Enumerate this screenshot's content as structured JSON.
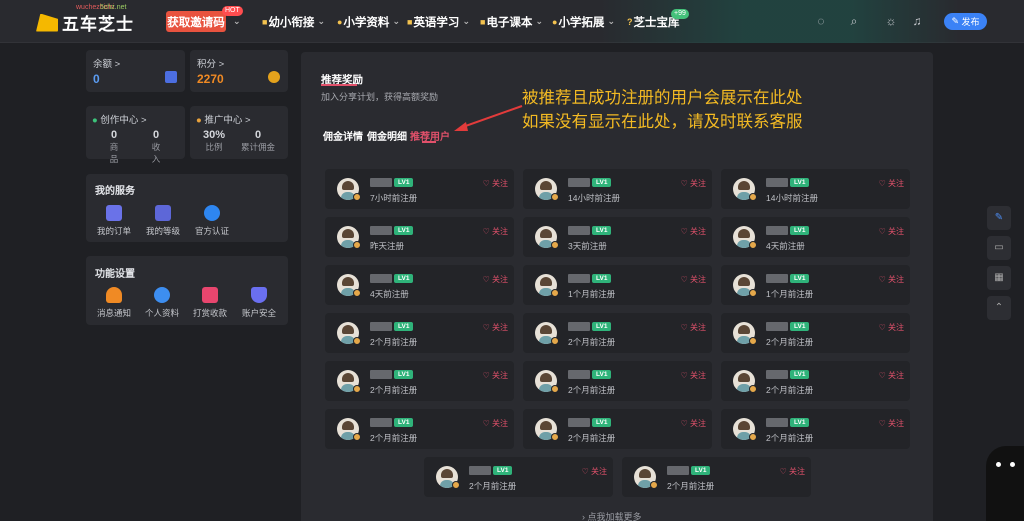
{
  "header": {
    "logo_text": "五车芝士",
    "logo_sub": "wuchezhishi",
    "logo_sub2": "5chz.net",
    "invite": "获取邀请码",
    "hot": "HOT",
    "nav": [
      "幼小衔接",
      "小学资料",
      "英语学习",
      "电子课本",
      "小学拓展",
      "芝士宝库"
    ],
    "badge99": "+99",
    "publish": "发布"
  },
  "left": {
    "balance_label": "余额 >",
    "balance_value": "0",
    "points_label": "积分 >",
    "points_value": "2270",
    "creation_title": "创作中心 >",
    "promo_title": "推广中心 >",
    "creation_stats": [
      {
        "v": "0",
        "l": "商品"
      },
      {
        "v": "0",
        "l": "收入"
      }
    ],
    "promo_stats": [
      {
        "v": "30%",
        "l": "比例"
      },
      {
        "v": "0",
        "l": "累计佣金"
      }
    ],
    "services_title": "我的服务",
    "services": [
      "我的订单",
      "我的等级",
      "官方认证"
    ],
    "settings_title": "功能设置",
    "settings": [
      "消息通知",
      "个人资料",
      "打赏收款",
      "账户安全"
    ]
  },
  "main": {
    "title": "推荐奖励",
    "subtitle": "加入分享计划，获得高额奖励",
    "tabs": [
      "佣金详情",
      "佣金明细",
      "推荐用户"
    ],
    "annotation": [
      "被推荐且成功注册的用户会展示在此处",
      "如果没有显示在此处，请及时联系客服"
    ],
    "level": "LV1",
    "follow": "♡ 关注",
    "load_more": "› 点我加载更多",
    "users": [
      "7小时前注册",
      "14小时前注册",
      "14小时前注册",
      "昨天注册",
      "3天前注册",
      "4天前注册",
      "4天前注册",
      "1个月前注册",
      "1个月前注册",
      "2个月前注册",
      "2个月前注册",
      "2个月前注册",
      "2个月前注册",
      "2个月前注册",
      "2个月前注册",
      "2个月前注册",
      "2个月前注册",
      "2个月前注册",
      "2个月前注册",
      "2个月前注册"
    ]
  }
}
